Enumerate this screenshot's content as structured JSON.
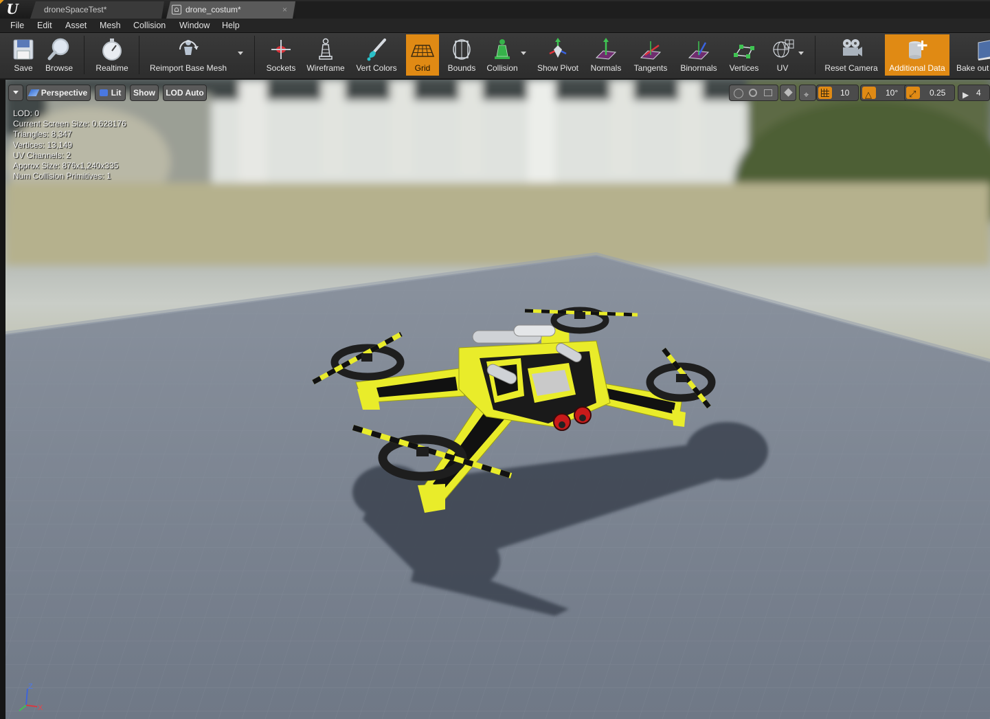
{
  "tabs": [
    {
      "label": "droneSpaceTest*"
    },
    {
      "label": "drone_costum*",
      "close": "×"
    }
  ],
  "menu": [
    "File",
    "Edit",
    "Asset",
    "Mesh",
    "Collision",
    "Window",
    "Help"
  ],
  "toolbar": {
    "save": "Save",
    "browse": "Browse",
    "realtime": "Realtime",
    "reimport": "Reimport Base Mesh",
    "sockets": "Sockets",
    "wireframe": "Wireframe",
    "vert_colors": "Vert Colors",
    "grid": "Grid",
    "bounds": "Bounds",
    "collision": "Collision",
    "show_pivot": "Show Pivot",
    "normals": "Normals",
    "tangents": "Tangents",
    "binormals": "Binormals",
    "vertices": "Vertices",
    "uv": "UV",
    "reset_camera": "Reset Camera",
    "additional_data": "Additional Data",
    "bake_out": "Bake out"
  },
  "viewport": {
    "perspective": "Perspective",
    "lit": "Lit",
    "show": "Show",
    "lod": "LOD Auto",
    "grid_snap": "10",
    "rotation_snap": "10°",
    "scale_snap": "0.25",
    "camera_speed": "4"
  },
  "stats": {
    "lod": "LOD:  0",
    "screen_size": "Current Screen Size:  0.628176",
    "triangles": "Triangles:  8,347",
    "vertices": "Vertices:  13,149",
    "uv_channels": "UV Channels:  2",
    "approx_size": "Approx Size: 876x1,240x335",
    "collision_prims": "Num Collision Primitives:  1"
  },
  "axis_labels": {
    "z": "Z",
    "x": "X"
  },
  "colors": {
    "accent": "#e08a14",
    "drone_yellow": "#e9ec2a",
    "floor": "#7c8593"
  }
}
